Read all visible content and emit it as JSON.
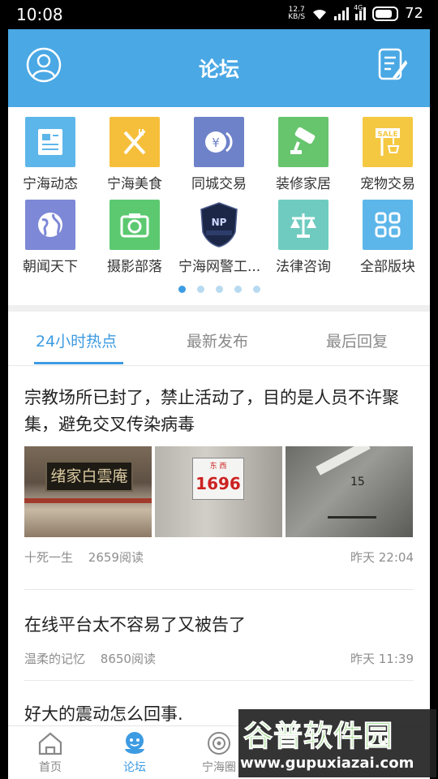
{
  "status_bar": {
    "time": "10:08",
    "net_speed_value": "12.7",
    "net_speed_unit": "KB/S",
    "network_type": "4G",
    "battery": "72"
  },
  "header": {
    "title": "论坛"
  },
  "categories": [
    {
      "label": "宁海动态",
      "icon": "news-icon",
      "color": "#5db6ea"
    },
    {
      "label": "宁海美食",
      "icon": "fork-knife-icon",
      "color": "#f6bf3b"
    },
    {
      "label": "同城交易",
      "icon": "yen-coin-icon",
      "color": "#6e82c9"
    },
    {
      "label": "装修家居",
      "icon": "paint-roller-icon",
      "color": "#67c56d"
    },
    {
      "label": "宠物交易",
      "icon": "sale-sign-icon",
      "color": "#f5c842"
    },
    {
      "label": "朝闻天下",
      "icon": "globe-icon",
      "color": "#7d88d6"
    },
    {
      "label": "摄影部落",
      "icon": "camera-icon",
      "color": "#5cc970"
    },
    {
      "label": "宁海网警工...",
      "icon": "police-badge-icon",
      "color": "#1c2748"
    },
    {
      "label": "法律咨询",
      "icon": "scales-icon",
      "color": "#6fcbc0"
    },
    {
      "label": "全部版块",
      "icon": "grid-icon",
      "color": "#5db6ea"
    }
  ],
  "pager": {
    "count": 5,
    "active": 0
  },
  "tabs": [
    {
      "label": "24小时热点",
      "active": true
    },
    {
      "label": "最新发布",
      "active": false
    },
    {
      "label": "最后回复",
      "active": false
    }
  ],
  "posts": [
    {
      "title": "宗教场所已封了，禁止活动了，目的是人员不许聚集，避免交叉传染病毒",
      "author": "十死一生",
      "reads": "2659阅读",
      "time": "昨天 22:04",
      "images": [
        {
          "plaque": "绪家白雲庵"
        },
        {
          "top": "东 西",
          "number": "1696"
        },
        {
          "mark": "15"
        }
      ]
    },
    {
      "title": "在线平台太不容易了又被告了",
      "author": "温柔的记忆",
      "reads": "8650阅读",
      "time": "昨天 11:39"
    },
    {
      "title": "好大的震动怎么回事."
    }
  ],
  "bottom_nav": [
    {
      "label": "首页",
      "icon": "home-icon"
    },
    {
      "label": "论坛",
      "icon": "forum-mascot-icon",
      "active": true
    },
    {
      "label": "宁海圈",
      "icon": "circle-icon"
    }
  ],
  "watermark": {
    "title": "谷普软件园",
    "url": "www.gupuxiazai.com"
  }
}
